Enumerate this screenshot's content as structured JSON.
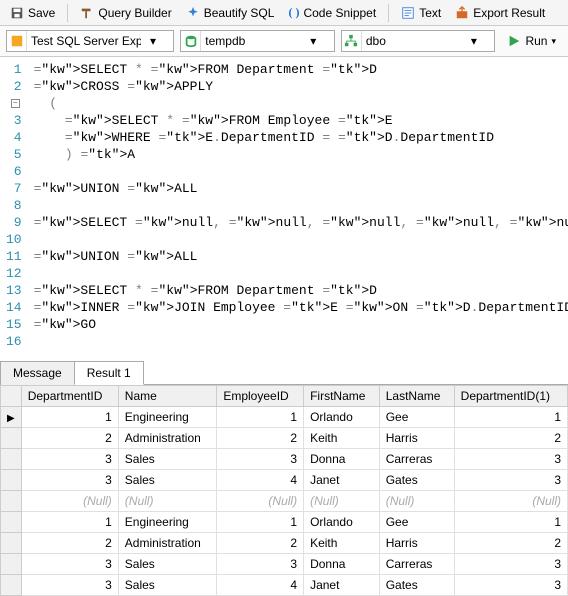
{
  "toolbar": {
    "save": "Save",
    "query_builder": "Query Builder",
    "beautify": "Beautify SQL",
    "snippet": "Code Snippet",
    "text": "Text",
    "export": "Export Result"
  },
  "connection": {
    "server": "Test SQL Server Expres",
    "database": "tempdb",
    "schema": "dbo",
    "run": "Run"
  },
  "code_lines": [
    {
      "n": "1",
      "t": "SELECT * FROM Department D",
      "cls": [
        "kw",
        "kw",
        "kw",
        "",
        "tk"
      ]
    },
    {
      "n": "2",
      "t": "CROSS APPLY"
    },
    {
      "n": "3",
      "t": "  ("
    },
    {
      "n": "4",
      "t": "    SELECT * FROM Employee E"
    },
    {
      "n": "5",
      "t": "    WHERE E.DepartmentID = D.DepartmentID"
    },
    {
      "n": "6",
      "t": "    ) A"
    },
    {
      "n": "7",
      "t": ""
    },
    {
      "n": "8",
      "t": "UNION ALL"
    },
    {
      "n": "9",
      "t": ""
    },
    {
      "n": "10",
      "t": "SELECT null, null, null, null, null, null"
    },
    {
      "n": "11",
      "t": ""
    },
    {
      "n": "12",
      "t": "UNION ALL"
    },
    {
      "n": "13",
      "t": ""
    },
    {
      "n": "14",
      "t": "SELECT * FROM Department D"
    },
    {
      "n": "15",
      "t": "INNER JOIN Employee E ON D.DepartmentID = E.DepartmentID"
    },
    {
      "n": "16",
      "t": "GO"
    }
  ],
  "tabs": {
    "message": "Message",
    "result": "Result 1"
  },
  "results": {
    "columns": [
      "DepartmentID",
      "Name",
      "EmployeeID",
      "FirstName",
      "LastName",
      "DepartmentID(1)"
    ],
    "rows": [
      {
        "DepartmentID": "1",
        "Name": "Engineering",
        "EmployeeID": "1",
        "FirstName": "Orlando",
        "LastName": "Gee",
        "DepartmentID(1)": "1",
        "ptr": true
      },
      {
        "DepartmentID": "2",
        "Name": "Administration",
        "EmployeeID": "2",
        "FirstName": "Keith",
        "LastName": "Harris",
        "DepartmentID(1)": "2"
      },
      {
        "DepartmentID": "3",
        "Name": "Sales",
        "EmployeeID": "3",
        "FirstName": "Donna",
        "LastName": "Carreras",
        "DepartmentID(1)": "3"
      },
      {
        "DepartmentID": "3",
        "Name": "Sales",
        "EmployeeID": "4",
        "FirstName": "Janet",
        "LastName": "Gates",
        "DepartmentID(1)": "3"
      },
      {
        "DepartmentID": null,
        "Name": null,
        "EmployeeID": null,
        "FirstName": null,
        "LastName": null,
        "DepartmentID(1)": null
      },
      {
        "DepartmentID": "1",
        "Name": "Engineering",
        "EmployeeID": "1",
        "FirstName": "Orlando",
        "LastName": "Gee",
        "DepartmentID(1)": "1"
      },
      {
        "DepartmentID": "2",
        "Name": "Administration",
        "EmployeeID": "2",
        "FirstName": "Keith",
        "LastName": "Harris",
        "DepartmentID(1)": "2"
      },
      {
        "DepartmentID": "3",
        "Name": "Sales",
        "EmployeeID": "3",
        "FirstName": "Donna",
        "LastName": "Carreras",
        "DepartmentID(1)": "3"
      },
      {
        "DepartmentID": "3",
        "Name": "Sales",
        "EmployeeID": "4",
        "FirstName": "Janet",
        "LastName": "Gates",
        "DepartmentID(1)": "3"
      }
    ],
    "null_text": "(Null)"
  }
}
